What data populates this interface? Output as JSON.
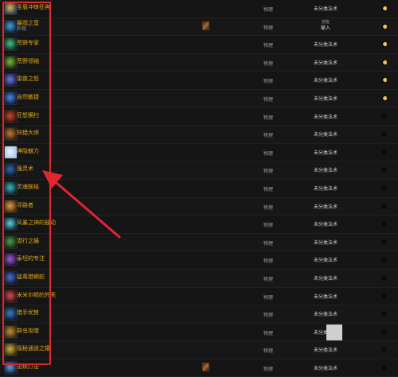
{
  "colors": {
    "background": "#141414",
    "spell_name": "#e2a81a",
    "highlight": "#e1262e"
  },
  "rows": [
    {
      "name": "圣盾冲锋狂奔",
      "sub": "",
      "school": "物理",
      "type": "未分类法术",
      "type_sub": "",
      "indicator": "moon",
      "icon": "flag-icon",
      "c1": "#2a3a5a",
      "c2": "#d6b546",
      "mini": false
    },
    {
      "name": "暴雨之蛮",
      "sub": "外观",
      "school": "物理",
      "type": "输入",
      "type_sub": "技能",
      "indicator": "moon",
      "icon": "storm-icon",
      "c1": "#0d2540",
      "c2": "#3fa6d8",
      "mini": true
    },
    {
      "name": "荒野专家",
      "sub": "",
      "school": "物理",
      "type": "未分类法术",
      "type_sub": "",
      "indicator": "moon",
      "icon": "wild-icon",
      "c1": "#0d3020",
      "c2": "#48c08a",
      "mini": false
    },
    {
      "name": "荒野领袖",
      "sub": "",
      "school": "物理",
      "type": "未分类法术",
      "type_sub": "",
      "indicator": "moon",
      "icon": "leader-icon",
      "c1": "#1c2a10",
      "c2": "#7ac23a",
      "mini": false
    },
    {
      "name": "雷霆之怒",
      "sub": "",
      "school": "物理",
      "type": "未分类法术",
      "type_sub": "",
      "indicator": "moon",
      "icon": "thunder-icon",
      "c1": "#1a1f45",
      "c2": "#6a7be0",
      "mini": false
    },
    {
      "name": "自然敏捷",
      "sub": "",
      "school": "物理",
      "type": "未分类法术",
      "type_sub": "",
      "indicator": "moon",
      "icon": "nature-icon",
      "c1": "#0f1e45",
      "c2": "#4a8ae6",
      "mini": false
    },
    {
      "name": "狂怒横扫",
      "sub": "",
      "school": "物理",
      "type": "未分类法术",
      "type_sub": "",
      "indicator": "dot",
      "icon": "sweep-icon",
      "c1": "#3a1010",
      "c2": "#c64a2a",
      "mini": false
    },
    {
      "name": "狩猎大师",
      "sub": "",
      "school": "物理",
      "type": "未分类法术",
      "type_sub": "",
      "indicator": "dot",
      "icon": "hunt-icon",
      "c1": "#3a2010",
      "c2": "#c07a3a",
      "mini": false
    },
    {
      "name": "神隐魅力",
      "sub": "",
      "school": "物理",
      "type": "未分类法术",
      "type_sub": "",
      "indicator": "dot",
      "icon": "charm-icon",
      "c1": "#a8c8e8",
      "c2": "#e8f4ff",
      "mini": false
    },
    {
      "name": "强灵术",
      "sub": "",
      "school": "物理",
      "type": "未分类法术",
      "type_sub": "",
      "indicator": "dot",
      "icon": "spirit-icon",
      "c1": "#0a1a30",
      "c2": "#3a6aa8",
      "mini": false
    },
    {
      "name": "灵魂联结",
      "sub": "",
      "school": "物理",
      "type": "未分类法术",
      "type_sub": "",
      "indicator": "dot",
      "icon": "soul-link-icon",
      "c1": "#0a2a30",
      "c2": "#40b8c8",
      "mini": false
    },
    {
      "name": "寻路者",
      "sub": "",
      "school": "物理",
      "type": "未分类法术",
      "type_sub": "",
      "indicator": "dot",
      "icon": "pathfinder-icon",
      "c1": "#4a2a10",
      "c2": "#e0a040",
      "mini": false
    },
    {
      "name": "风暴之神的鼓动",
      "sub": "",
      "school": "物理",
      "type": "未分类法术",
      "type_sub": "",
      "indicator": "dot",
      "icon": "wind-icon",
      "c1": "#0a3040",
      "c2": "#6ad0e0",
      "mini": false
    },
    {
      "name": "潜行之猫",
      "sub": "",
      "school": "物理",
      "type": "未分类法术",
      "type_sub": "",
      "indicator": "dot",
      "icon": "cat-icon",
      "c1": "#102a10",
      "c2": "#50a050",
      "mini": false
    },
    {
      "name": "泰坦的专注",
      "sub": "",
      "school": "物理",
      "type": "未分类法术",
      "type_sub": "",
      "indicator": "dot",
      "icon": "focus-icon",
      "c1": "#2a1040",
      "c2": "#9a60d0",
      "mini": false
    },
    {
      "name": "猛毒猎蝎蛇",
      "sub": "",
      "school": "物理",
      "type": "未分类法术",
      "type_sub": "",
      "indicator": "dot",
      "icon": "serpent-icon",
      "c1": "#101a40",
      "c2": "#5070c8",
      "mini": false
    },
    {
      "name": "米米尔顿的外壳",
      "sub": "",
      "school": "物理",
      "type": "未分类法术",
      "type_sub": "",
      "indicator": "dot",
      "icon": "shell-icon",
      "c1": "#3a1010",
      "c2": "#d05050",
      "mini": false
    },
    {
      "name": "猎手优势",
      "sub": "",
      "school": "物理",
      "type": "未分类法术",
      "type_sub": "",
      "indicator": "dot",
      "icon": "hunter-icon",
      "c1": "#102040",
      "c2": "#3a80c0",
      "mini": false
    },
    {
      "name": "群虫攻噬",
      "sub": "",
      "school": "物理",
      "type": "未分类法术",
      "type_sub": "",
      "indicator": "dot",
      "icon": "swarm-icon",
      "c1": "#3a2a10",
      "c2": "#c0903a",
      "mini": false
    },
    {
      "name": "隐秘通途之嬉",
      "sub": "",
      "school": "物理",
      "type": "未分类法术",
      "type_sub": "",
      "indicator": "dot",
      "icon": "crossed-arrows-icon",
      "c1": "#3a3010",
      "c2": "#d0b040",
      "mini": false
    },
    {
      "name": "迅疾打击",
      "sub": "",
      "school": "物理",
      "type": "未分类法术",
      "type_sub": "",
      "indicator": "dot",
      "icon": "strike-icon",
      "c1": "#102040",
      "c2": "#60a0e0",
      "mini": true
    }
  ]
}
